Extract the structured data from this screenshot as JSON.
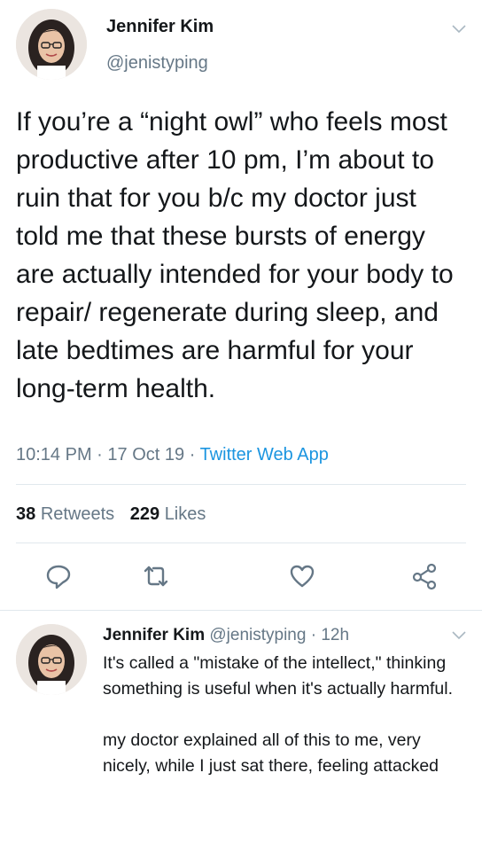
{
  "main_tweet": {
    "author_name": "Jennifer Kim",
    "author_handle": "@jenistyping",
    "text": "If you’re a “night owl” who feels most productive after 10 pm, I’m about to ruin that for you b/c my doctor just told me that these bursts of energy are actually intended for your body to repair/ regenerate during sleep, and late bedtimes are harmful for your long-term health.",
    "time": "10:14 PM",
    "sep1": "·",
    "date": "17 Oct 19",
    "sep2": "·",
    "source": "Twitter Web App",
    "retweets_count": "38",
    "retweets_label": "Retweets",
    "likes_count": "229",
    "likes_label": "Likes"
  },
  "actions": [
    "reply-icon",
    "retweet-icon",
    "like-icon",
    "share-icon"
  ],
  "reply_tweet": {
    "author_name": "Jennifer Kim",
    "author_handle": "@jenistyping",
    "sep": "·",
    "age": "12h",
    "text": "It's called a \"mistake of the intellect,\" thinking something is useful when it's actually harmful.\n\nmy doctor explained all of this to me, very nicely, while I just sat there, feeling attacked"
  },
  "colors": {
    "link": "#1b95e0",
    "muted": "#657786",
    "divider": "#e1e8ed",
    "text": "#14171a"
  }
}
